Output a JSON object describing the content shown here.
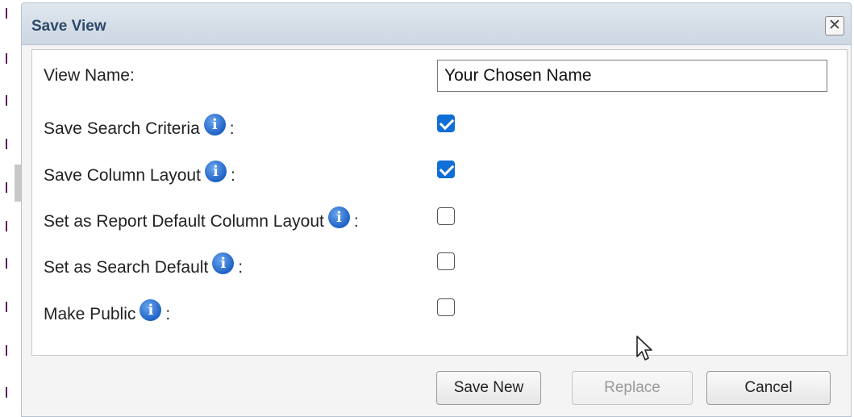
{
  "dialog": {
    "title": "Save View",
    "close_label": "✕"
  },
  "form": {
    "view_name_label": "View Name:",
    "view_name_value": "Your Chosen Name",
    "options": [
      {
        "label": "Save Search Criteria",
        "checked": true
      },
      {
        "label": "Save Column Layout",
        "checked": true
      },
      {
        "label": "Set as Report Default Column Layout",
        "checked": false
      },
      {
        "label": "Set as Search Default",
        "checked": false
      },
      {
        "label": "Make Public",
        "checked": false
      }
    ],
    "colon": ":",
    "info_glyph": "i"
  },
  "buttons": {
    "save_new": "Save New",
    "replace": "Replace",
    "cancel": "Cancel"
  },
  "colors": {
    "accent_checkbox": "#0f6fd6",
    "title_text": "#2d4a6a",
    "info_icon": "#1f62c6"
  },
  "icons": {
    "info": "info-icon",
    "close": "close-icon",
    "checkbox": "check-icon",
    "cursor": "mouse-cursor-icon"
  }
}
